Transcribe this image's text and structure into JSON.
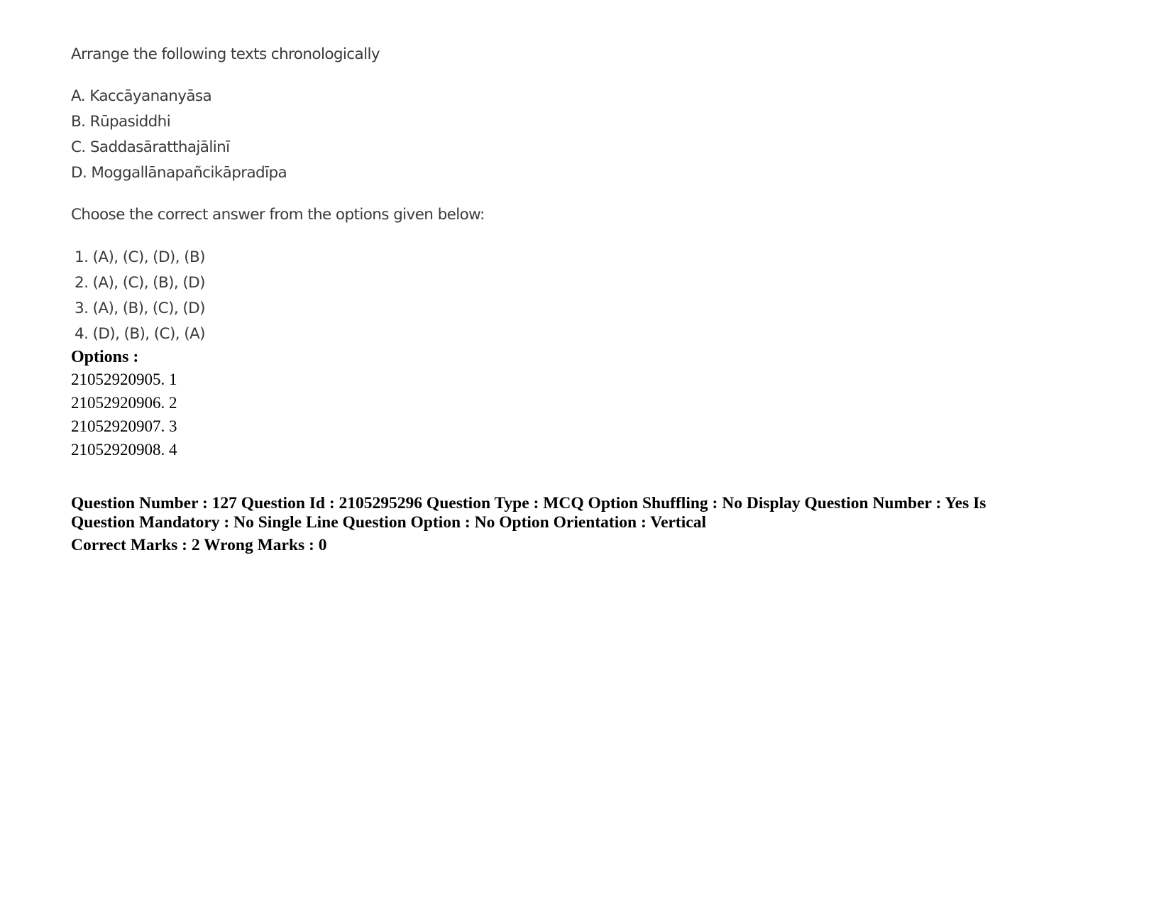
{
  "question": {
    "stem": "Arrange the following texts chronologically",
    "items": [
      "A. Kaccāyananyāsa",
      "B. Rūpasiddhi",
      "C. Saddasāratthajālinī",
      "D. Moggallānapañcikāpradīpa"
    ],
    "instruction": "Choose the correct answer from the options given below:",
    "choices": [
      "1. (A), (C), (D), (B)",
      "2. (A), (C), (B), (D)",
      "3. (A), (B), (C), (D)",
      "4. (D), (B), (C), (A)"
    ]
  },
  "options": {
    "label": "Options :",
    "list": [
      "21052920905. 1",
      "21052920906. 2",
      "21052920907. 3",
      "21052920908. 4"
    ]
  },
  "next_question_meta": {
    "line1": "Question Number : 127 Question Id : 2105295296 Question Type : MCQ Option Shuffling : No Display Question Number : Yes Is Question Mandatory : No Single Line Question Option : No Option Orientation : Vertical",
    "marks": "Correct Marks : 2 Wrong Marks : 0"
  }
}
